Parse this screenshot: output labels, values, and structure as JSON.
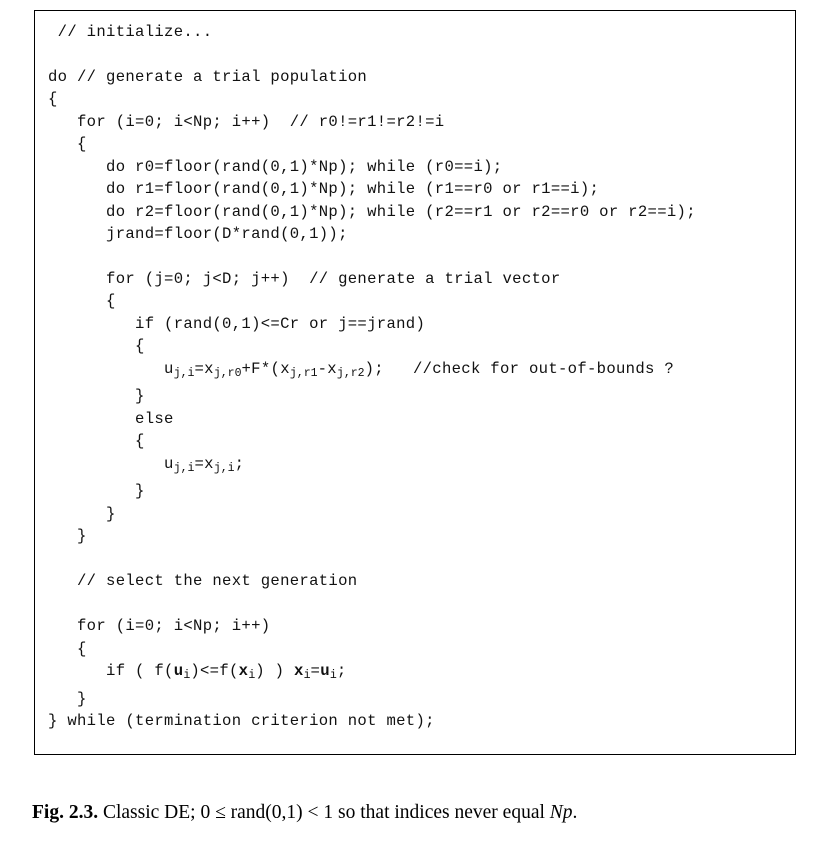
{
  "figure": {
    "box_border_color": "#000000",
    "background_color": "#ffffff",
    "text_color": "#111111",
    "code_lines": [
      {
        "id": "line-initialize",
        "text": " // initialize..."
      },
      {
        "id": "line-blank-1",
        "text": ""
      },
      {
        "id": "line-do",
        "text": "do // generate a trial population"
      },
      {
        "id": "line-open-brace-1",
        "text": "{"
      },
      {
        "id": "line-for-i-outer",
        "text": "   for (i=0; i<Np; i++)  // r0!=r1!=r2!=i"
      },
      {
        "id": "line-open-brace-2",
        "text": "   {"
      },
      {
        "id": "line-do-r0",
        "text": "      do r0=floor(rand(0,1)*Np); while (r0==i);"
      },
      {
        "id": "line-do-r1",
        "text": "      do r1=floor(rand(0,1)*Np); while (r1==r0 or r1==i);"
      },
      {
        "id": "line-do-r2",
        "text": "      do r2=floor(rand(0,1)*Np); while (r2==r1 or r2==r0 or r2==i);"
      },
      {
        "id": "line-jrand",
        "text": "      jrand=floor(D*rand(0,1));"
      },
      {
        "id": "line-blank-2",
        "text": ""
      },
      {
        "id": "line-for-j",
        "text": "      for (j=0; j<D; j++)  // generate a trial vector"
      },
      {
        "id": "line-open-brace-3",
        "text": "      {"
      },
      {
        "id": "line-if-cr",
        "text": "         if (rand(0,1)<=Cr or j==jrand)"
      },
      {
        "id": "line-open-brace-4",
        "text": "         {"
      },
      {
        "id": "line-mutation",
        "text": "            u[j,i]=x[j,r0]+F*(x[j,r1]-x[j,r2]);   //check for out-of-bounds ?",
        "rich": "            u<sub>j,i</sub>=x<sub>j,r0</sub>+F*(x<sub>j,r1</sub>-x<sub>j,r2</sub>);   //check for out-of-bounds ?"
      },
      {
        "id": "line-close-brace-4",
        "text": "         }"
      },
      {
        "id": "line-else",
        "text": "         else"
      },
      {
        "id": "line-open-brace-5",
        "text": "         {"
      },
      {
        "id": "line-copy",
        "text": "            u[j,i]=x[j,i];",
        "rich": "            u<sub>j,i</sub>=x<sub>j,i</sub>;"
      },
      {
        "id": "line-close-brace-5",
        "text": "         }"
      },
      {
        "id": "line-close-brace-3",
        "text": "      }"
      },
      {
        "id": "line-close-brace-2",
        "text": "   }"
      },
      {
        "id": "line-blank-3",
        "text": ""
      },
      {
        "id": "line-comment-select",
        "text": "   // select the next generation"
      },
      {
        "id": "line-blank-4",
        "text": ""
      },
      {
        "id": "line-for-i-inner",
        "text": "   for (i=0; i<Np; i++)"
      },
      {
        "id": "line-open-brace-6",
        "text": "   {"
      },
      {
        "id": "line-selection",
        "text": "      if ( f(u[i])<=f(x[i]) ) x[i]=u[i];",
        "rich": "      if ( f(<b>u</b><sub>i</sub>)<=f(<b>x</b><sub>i</sub>) ) <b>x</b><sub>i</sub>=<b>u</b><sub>i</sub>;"
      },
      {
        "id": "line-close-brace-6",
        "text": "   }"
      },
      {
        "id": "line-while",
        "text": "} while (termination criterion not met);"
      }
    ]
  },
  "caption": {
    "label": "Fig. 2.3.",
    "body_before_italic": " Classic DE; 0 ≤ rand(0,1) < 1 so that indices never equal ",
    "italic_term": "Np",
    "body_after_italic": ".",
    "full_text": "Fig. 2.3. Classic DE; 0 ≤ rand(0,1) < 1 so that indices never equal Np."
  }
}
